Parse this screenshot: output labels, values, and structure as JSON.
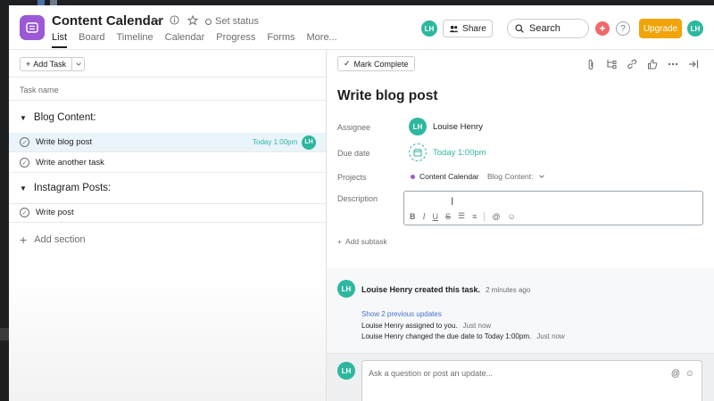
{
  "header": {
    "project_title": "Content Calendar",
    "set_status": "Set status",
    "avatar_initials": "LH",
    "share_label": "Share",
    "search_placeholder": "Search",
    "plus_glyph": "+",
    "help_glyph": "?",
    "upgrade_label": "Upgrade",
    "nav": [
      "List",
      "Board",
      "Timeline",
      "Calendar",
      "Progress",
      "Forms",
      "More..."
    ],
    "active_nav": "List"
  },
  "list": {
    "add_task_label": "Add Task",
    "column_header": "Task name",
    "sections": [
      {
        "title": "Blog Content:",
        "tasks": [
          {
            "name": "Write blog post",
            "due": "Today 1:00pm",
            "assignee": "LH",
            "selected": true
          },
          {
            "name": "Write another task",
            "due": "",
            "assignee": "",
            "selected": false
          }
        ]
      },
      {
        "title": "Instagram Posts:",
        "tasks": [
          {
            "name": "Write post",
            "due": "",
            "assignee": "",
            "selected": false
          }
        ]
      }
    ],
    "add_section_label": "Add section"
  },
  "detail": {
    "mark_complete_label": "Mark Complete",
    "title": "Write blog post",
    "labels": {
      "assignee": "Assignee",
      "due_date": "Due date",
      "projects": "Projects",
      "description": "Description"
    },
    "assignee_initials": "LH",
    "assignee_name": "Louise Henry",
    "due_value": "Today 1:00pm",
    "project_name": "Content Calendar",
    "project_section": "Blog Content:",
    "add_subtask_label": "Add subtask"
  },
  "activity": {
    "avatar_initials": "LH",
    "main_text": "Louise Henry created this task.",
    "main_time": "2 minutes ago",
    "show_previous": "Show 2 previous updates",
    "lines": [
      {
        "text": "Louise Henry assigned to you.",
        "time": "Just now"
      },
      {
        "text": "Louise Henry changed the due date to Today 1:00pm.",
        "time": "Just now"
      }
    ]
  },
  "comment": {
    "avatar_initials": "LH",
    "placeholder": "Ask a question or post an update..."
  },
  "colors": {
    "accent_green": "#2db79f",
    "project_purple": "#9b59d6",
    "upgrade_orange": "#f1a409",
    "plus_red": "#f06a6a",
    "link_blue": "#4573d2"
  }
}
